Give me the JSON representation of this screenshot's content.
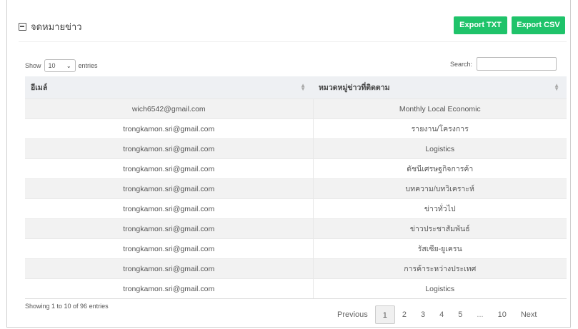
{
  "header": {
    "title": "จดหมายข่าว",
    "icon": "edit-icon"
  },
  "toolbar": {
    "export_txt": "Export TXT",
    "export_csv": "Export CSV",
    "accent": "#1fc36a"
  },
  "length": {
    "show": "Show",
    "value": "10",
    "entries": "entries"
  },
  "search": {
    "label": "Search:",
    "value": ""
  },
  "table": {
    "columns": [
      "อีเมล์",
      "หมวดหมู่ข่าวที่ติดตาม"
    ],
    "rows": [
      [
        "wich6542@gmail.com",
        "Monthly Local Economic"
      ],
      [
        "trongkamon.sri@gmail.com",
        "รายงาน/โครงการ"
      ],
      [
        "trongkamon.sri@gmail.com",
        "Logistics"
      ],
      [
        "trongkamon.sri@gmail.com",
        "ดัชนีเศรษฐกิจการค้า"
      ],
      [
        "trongkamon.sri@gmail.com",
        "บทความ/บทวิเคราะห์"
      ],
      [
        "trongkamon.sri@gmail.com",
        "ข่าวทั่วไป"
      ],
      [
        "trongkamon.sri@gmail.com",
        "ข่าวประชาสัมพันธ์"
      ],
      [
        "trongkamon.sri@gmail.com",
        "รัสเซีย-ยูเครน"
      ],
      [
        "trongkamon.sri@gmail.com",
        "การค้าระหว่างประเทศ"
      ],
      [
        "trongkamon.sri@gmail.com",
        "Logistics"
      ]
    ]
  },
  "info": "Showing 1 to 10 of 96 entries",
  "pagination": {
    "previous": "Previous",
    "pages": [
      "1",
      "2",
      "3",
      "4",
      "5",
      "...",
      "10"
    ],
    "active": "1",
    "next": "Next"
  }
}
